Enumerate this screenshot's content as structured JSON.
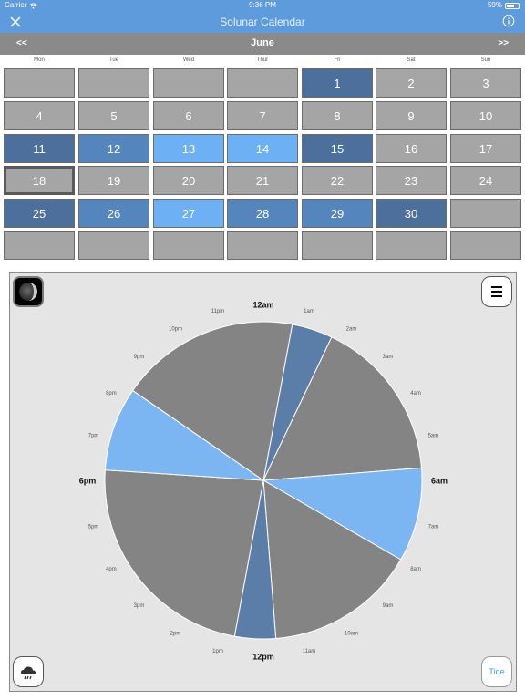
{
  "status": {
    "carrier": "Carrier",
    "time": "9:36 PM",
    "battery": "59%",
    "battery_level": 0.59
  },
  "nav": {
    "title": "Solunar Calendar",
    "close_icon": "close-x-icon",
    "info_icon": "info-icon"
  },
  "month": {
    "prev_label": "<<",
    "title": "June",
    "next_label": ">>"
  },
  "weekdays": [
    "Mon",
    "Tue",
    "Wed",
    "Thur",
    "Fri",
    "Sat",
    "Sun"
  ],
  "calendar": {
    "rows": [
      [
        {
          "day": "",
          "state": "gray"
        },
        {
          "day": "",
          "state": "gray"
        },
        {
          "day": "",
          "state": "gray"
        },
        {
          "day": "",
          "state": "gray"
        },
        {
          "day": "1",
          "state": "dark"
        },
        {
          "day": "2",
          "state": "gray"
        },
        {
          "day": "3",
          "state": "gray"
        }
      ],
      [
        {
          "day": "4",
          "state": "gray"
        },
        {
          "day": "5",
          "state": "gray"
        },
        {
          "day": "6",
          "state": "gray"
        },
        {
          "day": "7",
          "state": "gray"
        },
        {
          "day": "8",
          "state": "gray"
        },
        {
          "day": "9",
          "state": "gray"
        },
        {
          "day": "10",
          "state": "gray"
        }
      ],
      [
        {
          "day": "11",
          "state": "dark"
        },
        {
          "day": "12",
          "state": "mid"
        },
        {
          "day": "13",
          "state": "light"
        },
        {
          "day": "14",
          "state": "light"
        },
        {
          "day": "15",
          "state": "dark"
        },
        {
          "day": "16",
          "state": "gray"
        },
        {
          "day": "17",
          "state": "gray"
        }
      ],
      [
        {
          "day": "18",
          "state": "selected"
        },
        {
          "day": "19",
          "state": "gray"
        },
        {
          "day": "20",
          "state": "gray"
        },
        {
          "day": "21",
          "state": "gray"
        },
        {
          "day": "22",
          "state": "gray"
        },
        {
          "day": "23",
          "state": "gray"
        },
        {
          "day": "24",
          "state": "gray"
        }
      ],
      [
        {
          "day": "25",
          "state": "dark"
        },
        {
          "day": "26",
          "state": "mid"
        },
        {
          "day": "27",
          "state": "light"
        },
        {
          "day": "28",
          "state": "mid"
        },
        {
          "day": "29",
          "state": "mid"
        },
        {
          "day": "30",
          "state": "dark"
        },
        {
          "day": "",
          "state": "gray"
        }
      ],
      [
        {
          "day": "",
          "state": "gray"
        },
        {
          "day": "",
          "state": "gray"
        },
        {
          "day": "",
          "state": "gray"
        },
        {
          "day": "",
          "state": "gray"
        },
        {
          "day": "",
          "state": "gray"
        },
        {
          "day": "",
          "state": "gray"
        },
        {
          "day": "",
          "state": "gray"
        }
      ]
    ]
  },
  "colors": {
    "header": "#5d9bdc",
    "month_bar": "#8a8a8a",
    "cell_gray": "#a5a5a5",
    "cell_dark": "#4c6f9c",
    "cell_mid": "#5585bd",
    "cell_light": "#6eb0f4",
    "slice_gray": "#848484",
    "slice_blue": "#5a7ea8",
    "slice_light": "#7bb5f2",
    "tide_text": "#4a96e0"
  },
  "clock": {
    "hour_labels": [
      "12am",
      "1am",
      "2am",
      "3am",
      "4am",
      "5am",
      "6am",
      "7am",
      "8am",
      "9am",
      "10am",
      "11am",
      "12pm",
      "1pm",
      "2pm",
      "3pm",
      "4pm",
      "5pm",
      "6pm",
      "7pm",
      "8pm",
      "9pm",
      "10pm",
      "11pm"
    ],
    "major_hours": [
      0,
      6,
      12,
      18
    ],
    "segments": [
      {
        "from": 0.7,
        "to": 1.7,
        "kind": "blue"
      },
      {
        "from": 1.7,
        "to": 5.7,
        "kind": "gray"
      },
      {
        "from": 5.7,
        "to": 8.0,
        "kind": "light"
      },
      {
        "from": 8.0,
        "to": 11.7,
        "kind": "gray"
      },
      {
        "from": 11.7,
        "to": 12.7,
        "kind": "blue"
      },
      {
        "from": 12.7,
        "to": 18.25,
        "kind": "gray"
      },
      {
        "from": 18.25,
        "to": 20.3,
        "kind": "light"
      },
      {
        "from": 20.3,
        "to": 24.7,
        "kind": "gray"
      }
    ]
  },
  "buttons": {
    "moon_icon": "moon-phase-icon",
    "menu_icon": "hamburger-menu-icon",
    "weather_icon": "weather-cloud-icon",
    "tide_label": "Tide"
  }
}
